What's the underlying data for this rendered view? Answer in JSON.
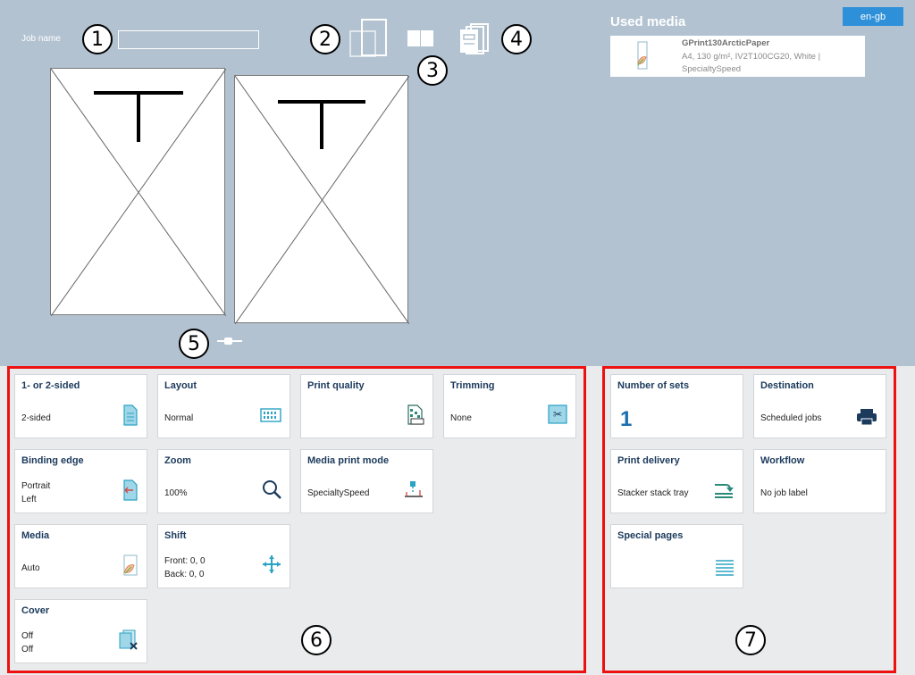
{
  "header": {
    "job_name_label": "Job name",
    "job_name_value": "",
    "language_button": "en-gb"
  },
  "used_media": {
    "title": "Used media",
    "name": "GPrint130ArcticPaper",
    "detail": "A4, 130 g/m², IV2T100CG20, White | SpecialtySpeed"
  },
  "callouts": [
    "1",
    "2",
    "3",
    "4",
    "5",
    "6",
    "7"
  ],
  "settings_tiles": [
    {
      "title": "1- or 2-sided",
      "value": "2-sided",
      "icon": "two-sided-document-icon"
    },
    {
      "title": "Layout",
      "value": "Normal",
      "icon": "layout-icon"
    },
    {
      "title": "Print quality",
      "value": "",
      "icon": "print-quality-icon"
    },
    {
      "title": "Trimming",
      "value": "None",
      "icon": "trimming-icon"
    },
    {
      "title": "Binding edge",
      "value": "Portrait\nLeft",
      "icon": "binding-edge-icon"
    },
    {
      "title": "Zoom",
      "value": "100%",
      "icon": "zoom-icon"
    },
    {
      "title": "Media print mode",
      "value": "SpecialtySpeed",
      "icon": "media-print-mode-icon"
    },
    {
      "title": "Media",
      "value": "Auto",
      "icon": "media-icon"
    },
    {
      "title": "Shift",
      "value": "Front: 0, 0\nBack: 0, 0",
      "icon": "shift-arrows-icon"
    },
    {
      "title": "Cover",
      "value": "Off\nOff",
      "icon": "cover-icon"
    }
  ],
  "output_tiles": [
    {
      "title": "Number of sets",
      "value": "1",
      "icon": ""
    },
    {
      "title": "Destination",
      "value": "Scheduled jobs",
      "icon": "printer-icon"
    },
    {
      "title": "Print delivery",
      "value": "Stacker stack tray",
      "icon": "stacker-tray-icon"
    },
    {
      "title": "Workflow",
      "value": "No job label",
      "icon": ""
    },
    {
      "title": "Special pages",
      "value": "",
      "icon": "special-pages-icon"
    }
  ],
  "colors": {
    "top_background": "#b2c2d1",
    "bottom_background": "#e9ebec",
    "accent_blue": "#2e90d8",
    "highlight_red": "#ee1111",
    "icon_teal": "#2aa3c4"
  }
}
